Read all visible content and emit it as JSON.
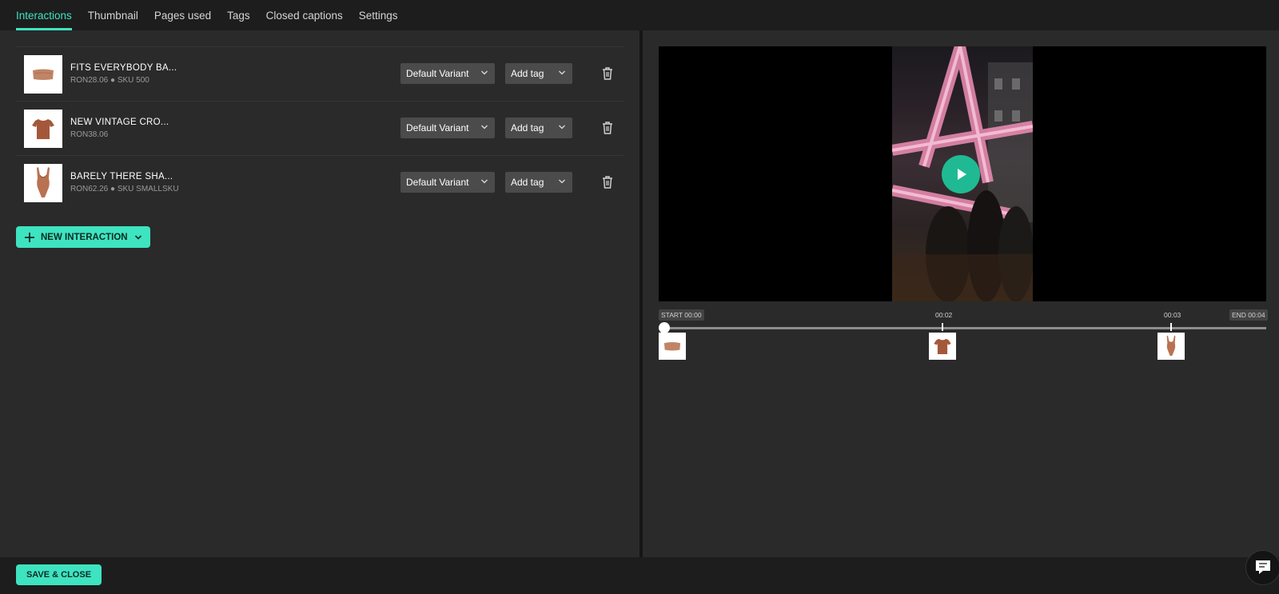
{
  "tabs": [
    {
      "label": "Interactions",
      "active": true
    },
    {
      "label": "Thumbnail"
    },
    {
      "label": "Pages used"
    },
    {
      "label": "Tags"
    },
    {
      "label": "Closed captions"
    },
    {
      "label": "Settings"
    }
  ],
  "interactions": [
    {
      "name": "FITS EVERYBODY BA...",
      "meta": "RON28.06 ● SKU 500",
      "variant": "Default Variant",
      "tag": "Add tag",
      "thumb_icon": "bandeau-top-icon"
    },
    {
      "name": "NEW VINTAGE CRO...",
      "meta": "RON38.06",
      "variant": "Default Variant",
      "tag": "Add tag",
      "thumb_icon": "tshirt-icon"
    },
    {
      "name": "BARELY THERE SHA...",
      "meta": "RON62.26 ● SKU SMALLSKU",
      "variant": "Default Variant",
      "tag": "Add tag",
      "thumb_icon": "bodysuit-icon"
    }
  ],
  "new_interaction_label": "NEW INTERACTION",
  "timeline": {
    "start_label": "START 00:00",
    "end_label": "END 00:04",
    "markers": [
      {
        "label": "00:02"
      },
      {
        "label": "00:03"
      }
    ],
    "playhead_fraction": 0.0
  },
  "footer": {
    "save_label": "SAVE & CLOSE"
  },
  "colors": {
    "accent": "#3ee3c0",
    "panel": "#2a2a2a",
    "bar": "#1d1d1d",
    "play": "#1fba93",
    "product": "#b06a4a"
  }
}
